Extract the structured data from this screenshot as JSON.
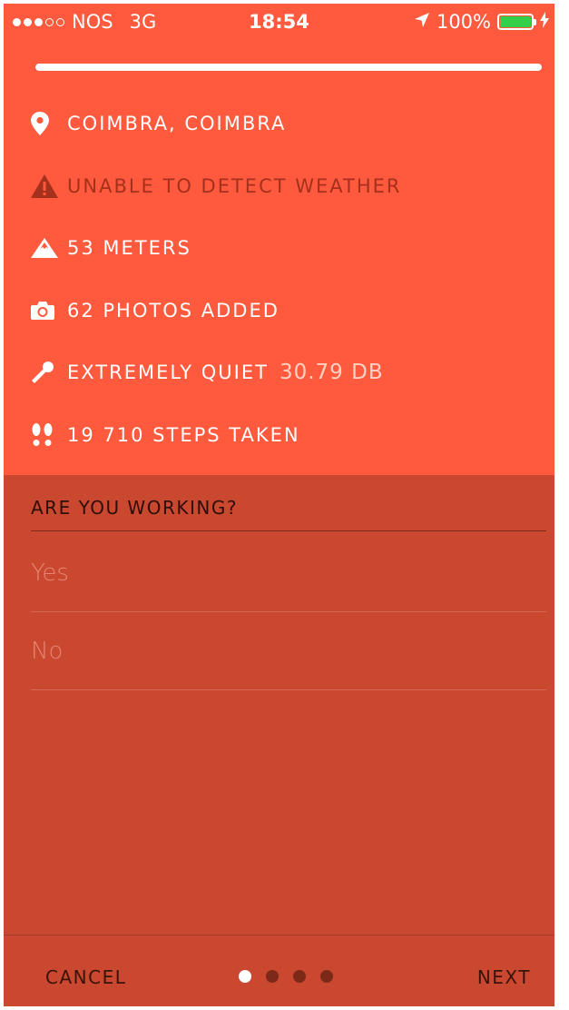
{
  "status_bar": {
    "carrier": "NOS",
    "network": "3G",
    "time": "18:54",
    "battery": "100%",
    "battery_level": 1.0,
    "signal_bars": 3,
    "signal_total": 5,
    "icons": [
      "location-arrow-icon",
      "battery-icon",
      "charging-bolt-icon"
    ]
  },
  "progress": {
    "value": 1.0
  },
  "info": {
    "location": "COIMBRA, COIMBRA",
    "weather": "UNABLE TO DETECT WEATHER",
    "altitude": "53 METERS",
    "photos": "62 PHOTOS ADDED",
    "noise": "EXTREMELY QUIET",
    "noise_value": "30.79 DB",
    "steps": "19 710 STEPS TAKEN",
    "icons": [
      "map-pin-icon",
      "warning-icon",
      "mountain-icon",
      "camera-icon",
      "microphone-icon",
      "footprints-icon"
    ]
  },
  "question": {
    "title": "ARE YOU WORKING?",
    "options": [
      "Yes",
      "No"
    ]
  },
  "footer": {
    "cancel": "CANCEL",
    "next": "NEXT",
    "pages": 4,
    "active_page": 1
  },
  "colors": {
    "accent": "#ff5a3e",
    "background": "#c9482f",
    "battery": "#35d04a"
  }
}
